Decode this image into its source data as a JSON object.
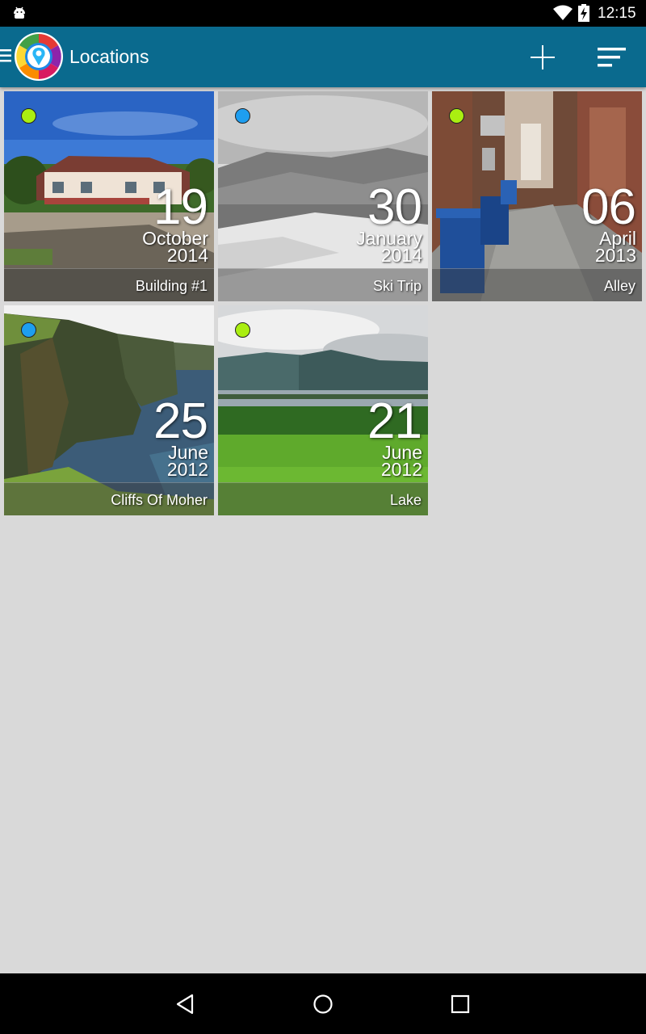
{
  "status_bar": {
    "time": "12:15",
    "icons": [
      "android-debug-icon",
      "wifi-icon",
      "battery-charging-icon"
    ]
  },
  "app_bar": {
    "title": "Locations",
    "icons": [
      "menu-icon",
      "app-logo-icon",
      "add-icon",
      "sort-icon"
    ]
  },
  "colors": {
    "app_bar": "#0a6a8e",
    "background": "#d9d9d9",
    "dot_green": "#aaee11",
    "dot_blue": "#1e9ef0"
  },
  "locations": [
    {
      "name": "Building #1",
      "day": "19",
      "month": "October",
      "year": "2014",
      "dot_color": "#aaee11"
    },
    {
      "name": "Ski Trip",
      "day": "30",
      "month": "January",
      "year": "2014",
      "dot_color": "#1e9ef0"
    },
    {
      "name": "Alley",
      "day": "06",
      "month": "April",
      "year": "2013",
      "dot_color": "#aaee11"
    },
    {
      "name": "Cliffs Of Moher",
      "day": "25",
      "month": "June",
      "year": "2012",
      "dot_color": "#1e9ef0"
    },
    {
      "name": "Lake",
      "day": "21",
      "month": "June",
      "year": "2012",
      "dot_color": "#aaee11"
    }
  ],
  "nav_bar": {
    "icons": [
      "back-icon",
      "home-icon",
      "recents-icon"
    ]
  }
}
